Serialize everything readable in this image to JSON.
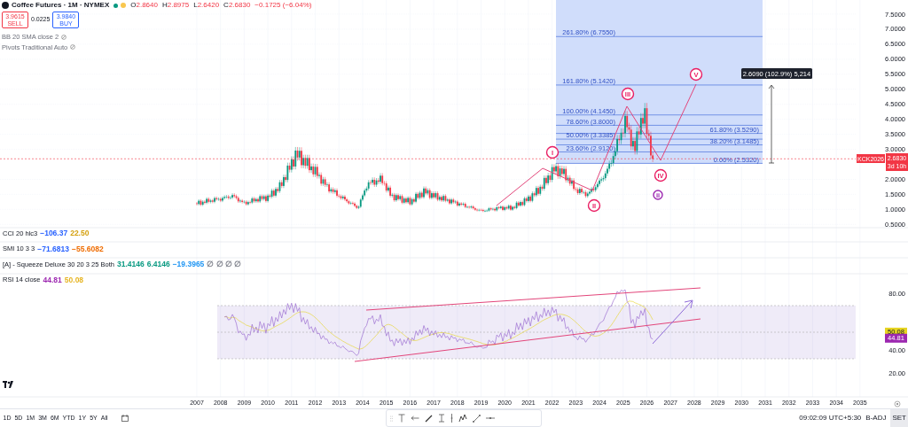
{
  "header": {
    "symbol": "Coffee Futures · 1M · NYMEX",
    "ohlc": [
      {
        "label": "O",
        "value": "2.8640"
      },
      {
        "label": "H",
        "value": "2.8975"
      },
      {
        "label": "L",
        "value": "2.6420"
      },
      {
        "label": "C",
        "value": "2.6830"
      }
    ],
    "change": "−0.1725 (−6.04%)"
  },
  "trade": {
    "sell_price": "3.9615",
    "sell_label": "SELL",
    "spread": "0.0225",
    "buy_price": "3.9840",
    "buy_label": "BUY"
  },
  "overlays": [
    "BB 20 SMA close 2",
    "Pivots Traditional Auto"
  ],
  "price_axis": [
    "7.5000",
    "7.0000",
    "6.5000",
    "6.0000",
    "5.5000",
    "5.0000",
    "4.5000",
    "4.0000",
    "3.5000",
    "3.0000",
    "2.0000",
    "1.5000",
    "1.0000",
    "0.5000"
  ],
  "last_price": {
    "symbol": "KCK2026",
    "price": "2.6830",
    "countdown": "3d 10h"
  },
  "fib_levels": [
    "261.80% (6.7550)",
    "161.80% (5.1420)",
    "100.00% (4.1450)",
    "78.60% (3.8000)",
    "61.80% (3.5290)",
    "50.00% (3.3385)",
    "38.20% (3.1485)",
    "23.60% (2.9120)",
    "0.00% (2.5320)"
  ],
  "waves": [
    {
      "label": "I",
      "color": "#e91e63"
    },
    {
      "label": "II",
      "color": "#e91e63"
    },
    {
      "label": "III",
      "color": "#e91e63"
    },
    {
      "label": "IV",
      "color": "#e91e63"
    },
    {
      "label": "V",
      "color": "#e91e63"
    },
    {
      "label": "ii",
      "color": "#9c27b0"
    }
  ],
  "measure_label": "2.6090 (102.9%) 5,214",
  "indicators": [
    {
      "name": "CCI 20 hlc3",
      "values": [
        {
          "text": "−106.37",
          "color": "#2962ff"
        },
        {
          "text": "22.50",
          "color": "#d4a00f"
        }
      ]
    },
    {
      "name": "SMI 10 3 3",
      "values": [
        {
          "text": "−71.6813",
          "color": "#2962ff"
        },
        {
          "text": "−55.6082",
          "color": "#ef6c00"
        }
      ]
    },
    {
      "name": "[A] - Squeeze Deluxe 30 20 3 25 Both",
      "values": [
        {
          "text": "31.4146",
          "color": "#089981"
        },
        {
          "text": "6.4146",
          "color": "#089981"
        },
        {
          "text": "−19.3965",
          "color": "#2196f3"
        },
        {
          "text": "∅ ∅ ∅ ∅"
        }
      ]
    },
    {
      "name": "RSI 14 close",
      "values": [
        {
          "text": "44.81",
          "color": "#9c27b0"
        },
        {
          "text": "50.08",
          "color": "#e6b422"
        }
      ]
    }
  ],
  "rsi_axis": [
    "80.00",
    "40.00",
    "20.00"
  ],
  "rsi_labels": [
    {
      "text": "50.08",
      "color": "#e6d422"
    },
    {
      "text": "44.81",
      "color": "#9c27b0"
    }
  ],
  "time_axis": [
    "2007",
    "2008",
    "2009",
    "2010",
    "2011",
    "2012",
    "2013",
    "2014",
    "2015",
    "2016",
    "2017",
    "2018",
    "2019",
    "2020",
    "2021",
    "2022",
    "2023",
    "2024",
    "2025",
    "2026",
    "2027",
    "2028",
    "2029",
    "2030",
    "2031",
    "2032",
    "2033",
    "2034",
    "2035"
  ],
  "timeframes": [
    "1D",
    "5D",
    "1M",
    "3M",
    "6M",
    "YTD",
    "1Y",
    "5Y",
    "All"
  ],
  "status": {
    "time": "09:02:09 UTC+5:30",
    "adjustment": "B-ADJ",
    "session": "SET"
  }
}
